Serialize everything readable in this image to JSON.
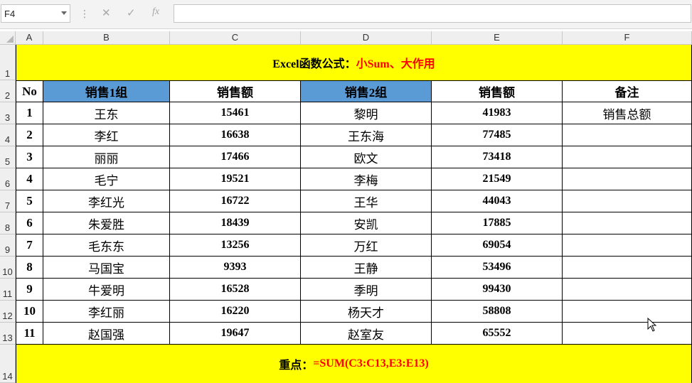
{
  "formula_bar": {
    "name_box": "F4",
    "separator": "⋮",
    "cancel_icon": "✕",
    "enter_icon": "✓",
    "fx_icon": "fx",
    "formula": ""
  },
  "columns": [
    "A",
    "B",
    "C",
    "D",
    "E",
    "F"
  ],
  "rows": [
    "1",
    "2",
    "3",
    "4",
    "5",
    "6",
    "7",
    "8",
    "9",
    "10",
    "11",
    "12",
    "13",
    "14"
  ],
  "title": {
    "black": "Excel函数公式：",
    "red": "小Sum、大作用"
  },
  "table": {
    "headers": [
      "No",
      "销售1组",
      "销售额",
      "销售2组",
      "销售额",
      "备注"
    ],
    "rows": [
      [
        "1",
        "王东",
        "15461",
        "黎明",
        "41983",
        "销售总额"
      ],
      [
        "2",
        "李红",
        "16638",
        "王东海",
        "77485",
        ""
      ],
      [
        "3",
        "丽丽",
        "17466",
        "欧文",
        "73418",
        ""
      ],
      [
        "4",
        "毛宁",
        "19521",
        "李梅",
        "21549",
        ""
      ],
      [
        "5",
        "李红光",
        "16722",
        "王华",
        "44043",
        ""
      ],
      [
        "6",
        "朱爱胜",
        "18439",
        "安凯",
        "17885",
        ""
      ],
      [
        "7",
        "毛东东",
        "13256",
        "万红",
        "69054",
        ""
      ],
      [
        "8",
        "马国宝",
        "9393",
        "王静",
        "53496",
        ""
      ],
      [
        "9",
        "牛爱明",
        "16528",
        "季明",
        "99430",
        ""
      ],
      [
        "10",
        "李红丽",
        "16220",
        "杨天才",
        "58808",
        ""
      ],
      [
        "11",
        "赵国强",
        "19647",
        "赵室友",
        "65552",
        ""
      ]
    ]
  },
  "footer": {
    "black": "重点：",
    "red": "=SUM(C3:C13,E3:E13)"
  },
  "colors": {
    "banner": "#ffff00",
    "header_blue": "#5b9bd5",
    "accent_red": "#ff0000"
  }
}
